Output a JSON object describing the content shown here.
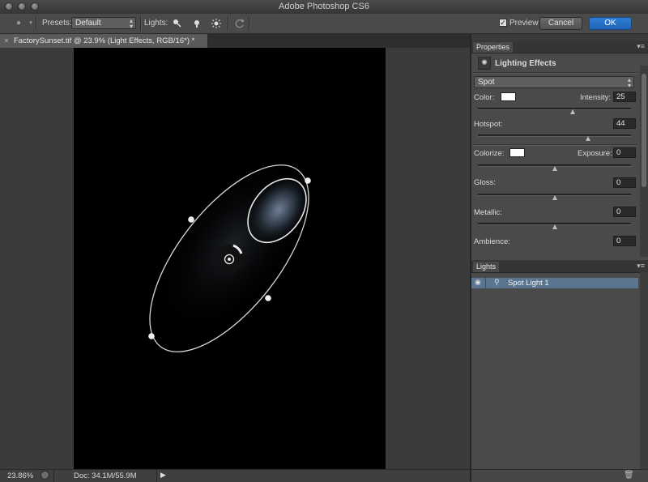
{
  "window": {
    "title": "Adobe Photoshop CS6"
  },
  "options_bar": {
    "presets_label": "Presets:",
    "presets_value": "Default",
    "lights_label": "Lights:",
    "preview_label": "Preview",
    "preview_checked": true,
    "cancel_label": "Cancel",
    "ok_label": "OK"
  },
  "document_tab": {
    "close_glyph": "×",
    "title": "FactorySunset.tif @ 23.9% (Light Effects, RGB/16*) *"
  },
  "status_bar": {
    "zoom": "23.86%",
    "doc_size": "Doc: 34.1M/55.9M"
  },
  "properties_panel": {
    "tab_label": "Properties",
    "header": "Lighting Effects",
    "light_type": "Spot",
    "color_label": "Color:",
    "color_swatch": "#ffffff",
    "intensity_label": "Intensity:",
    "intensity_value": "25",
    "hotspot_label": "Hotspot:",
    "hotspot_value": "44",
    "colorize_label": "Colorize:",
    "colorize_swatch": "#ffffff",
    "exposure_label": "Exposure:",
    "exposure_value": "0",
    "gloss_label": "Gloss:",
    "gloss_value": "0",
    "metallic_label": "Metallic:",
    "metallic_value": "0",
    "ambience_label": "Ambience:",
    "ambience_value": "0",
    "slider_levels": {
      "intensity": 0.62,
      "hotspot": 0.72,
      "exposure": 0.5,
      "gloss": 0.5,
      "metallic": 0.5
    }
  },
  "lights_panel": {
    "tab_label": "Lights",
    "items": [
      {
        "name": "Spot Light 1",
        "visible": true,
        "selected": true
      }
    ]
  },
  "colors": {
    "accent": "#1f63b5",
    "selection": "#5b7590"
  },
  "icons": [
    "bulb-icon",
    "spot-light-icon",
    "point-light-icon",
    "infinite-light-icon",
    "reset-icon",
    "eye-icon",
    "trash-icon",
    "lighting-effects-icon",
    "panel-menu-icon"
  ]
}
